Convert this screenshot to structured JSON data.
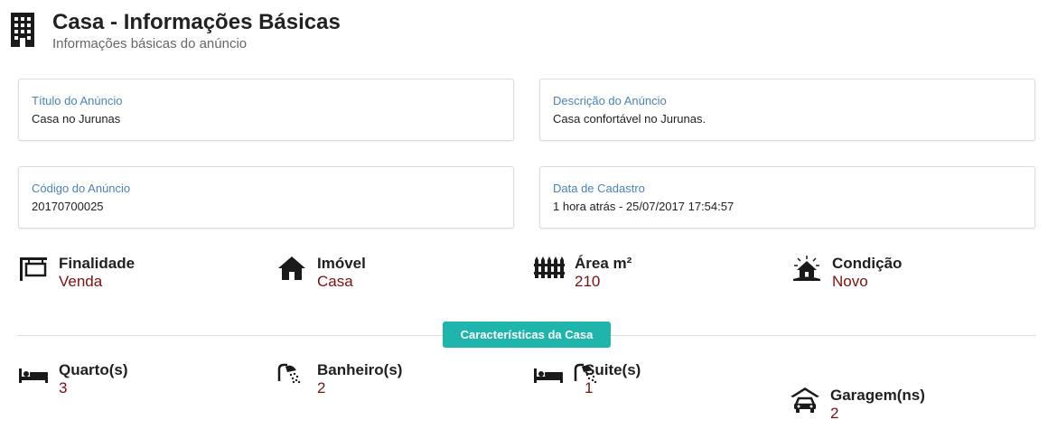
{
  "header": {
    "icon": "building-icon",
    "title": "Casa - Informações Básicas",
    "subtitle": "Informações básicas do anúncio"
  },
  "cards": [
    {
      "label": "Título do Anúncio",
      "value": "Casa no Jurunas"
    },
    {
      "label": "Descrição do Anúncio",
      "value": "Casa confortável no Jurunas."
    },
    {
      "label": "Código do Anúncio",
      "value": "20170700025"
    },
    {
      "label": "Data de Cadastro",
      "value": "1 hora atrás - 25/07/2017 17:54:57"
    }
  ],
  "summary": [
    {
      "icon": "for-sale-sign-icon",
      "label": "Finalidade",
      "value": "Venda"
    },
    {
      "icon": "house-icon",
      "label": "Imóvel",
      "value": "Casa"
    },
    {
      "icon": "fence-icon",
      "label": "Área m²",
      "value": "210"
    },
    {
      "icon": "new-house-icon",
      "label": "Condição",
      "value": "Novo"
    }
  ],
  "section": {
    "badge": "Características da Casa"
  },
  "features": [
    {
      "icon": "bed-icon",
      "label": "Quarto(s)",
      "value": "3"
    },
    {
      "icon": "shower-icon",
      "label": "Banheiro(s)",
      "value": "2"
    },
    {
      "icon": "suite-icon",
      "label": "Suite(s)",
      "value": "1"
    },
    {
      "icon": "garage-car-icon",
      "label": "Garagem(ns)",
      "value": "2"
    }
  ],
  "colors": {
    "label_blue": "#4a82b8",
    "value_red": "#7b1010",
    "badge_teal": "#1fb5ac"
  }
}
